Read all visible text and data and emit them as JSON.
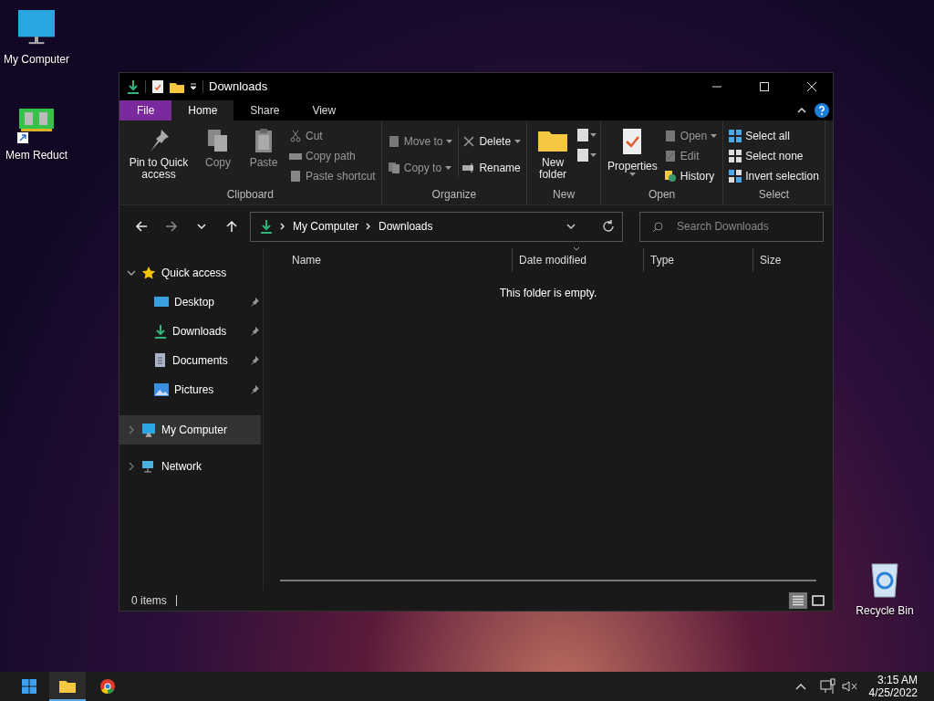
{
  "desktop_icons": [
    {
      "label": "My Computer"
    },
    {
      "label": "Mem Reduct"
    },
    {
      "label": "Recycle Bin"
    }
  ],
  "window": {
    "title": "Downloads"
  },
  "ribbon_tabs": [
    {
      "label": "File",
      "selected": false,
      "kind": "file"
    },
    {
      "label": "Home",
      "selected": true,
      "kind": "tab"
    },
    {
      "label": "Share",
      "selected": false,
      "kind": "tab"
    },
    {
      "label": "View",
      "selected": false,
      "kind": "tab"
    }
  ],
  "ribbon_groups": [
    {
      "label": "Clipboard",
      "items": [
        {
          "kind": "large",
          "label": "Pin to Quick access",
          "disabled": false
        },
        {
          "kind": "large",
          "label": "Copy",
          "disabled": true
        },
        {
          "kind": "large",
          "label": "Paste",
          "disabled": true
        },
        {
          "kind": "stack",
          "items": [
            {
              "label": "Cut",
              "disabled": true,
              "dropdown": false
            },
            {
              "label": "Copy path",
              "disabled": true,
              "dropdown": false
            },
            {
              "label": "Paste shortcut",
              "disabled": true,
              "dropdown": false
            }
          ]
        }
      ]
    },
    {
      "label": "Organize",
      "items": [
        {
          "kind": "stack",
          "items": [
            {
              "label": "Move to",
              "disabled": true,
              "dropdown": true
            },
            {
              "label": "Copy to",
              "disabled": true,
              "dropdown": true
            }
          ]
        },
        {
          "kind": "stack",
          "items": [
            {
              "label": "Delete",
              "disabled": false,
              "dropdown": true
            },
            {
              "label": "Rename",
              "disabled": false,
              "dropdown": false
            }
          ]
        }
      ]
    },
    {
      "label": "New",
      "items": [
        {
          "kind": "large",
          "label": "New folder",
          "disabled": false
        },
        {
          "kind": "iconstack",
          "items": [
            {
              "dropdown": true
            },
            {
              "dropdown": true
            }
          ]
        }
      ]
    },
    {
      "label": "Open",
      "items": [
        {
          "kind": "large",
          "label": "Properties",
          "disabled": false,
          "dropdown": true
        },
        {
          "kind": "stack",
          "items": [
            {
              "label": "Open",
              "disabled": true,
              "dropdown": true
            },
            {
              "label": "Edit",
              "disabled": true,
              "dropdown": false
            },
            {
              "label": "History",
              "disabled": false,
              "dropdown": false
            }
          ]
        }
      ]
    },
    {
      "label": "Select",
      "items": [
        {
          "kind": "stack",
          "items": [
            {
              "label": "Select all",
              "disabled": false,
              "dropdown": false
            },
            {
              "label": "Select none",
              "disabled": false,
              "dropdown": false
            },
            {
              "label": "Invert selection",
              "disabled": false,
              "dropdown": false
            }
          ]
        }
      ]
    }
  ],
  "nav": {
    "back_disabled": false,
    "forward_disabled": true,
    "breadcrumb": [
      "My Computer",
      "Downloads"
    ],
    "search": {
      "placeholder": "Search Downloads"
    }
  },
  "sidebar": {
    "items": [
      {
        "label": "Quick access",
        "expanded": true,
        "selected": false,
        "children": [
          {
            "label": "Desktop",
            "pinned": true
          },
          {
            "label": "Downloads",
            "pinned": true
          },
          {
            "label": "Documents",
            "pinned": true
          },
          {
            "label": "Pictures",
            "pinned": true
          }
        ]
      },
      {
        "label": "My Computer",
        "expanded": false,
        "selected": true
      },
      {
        "label": "Network",
        "expanded": false,
        "selected": false
      }
    ]
  },
  "table": {
    "columns": [
      {
        "label": "Name",
        "sorted": false
      },
      {
        "label": "Date modified",
        "sorted": true
      },
      {
        "label": "Type",
        "sorted": false
      },
      {
        "label": "Size",
        "sorted": false
      }
    ],
    "empty_message": "This folder is empty."
  },
  "status_bar": {
    "count": "0 items",
    "view_buttons": [
      {
        "selected": true
      },
      {
        "selected": false
      }
    ]
  },
  "taskbar": {
    "time": "3:15 AM",
    "date": "4/25/2022"
  }
}
